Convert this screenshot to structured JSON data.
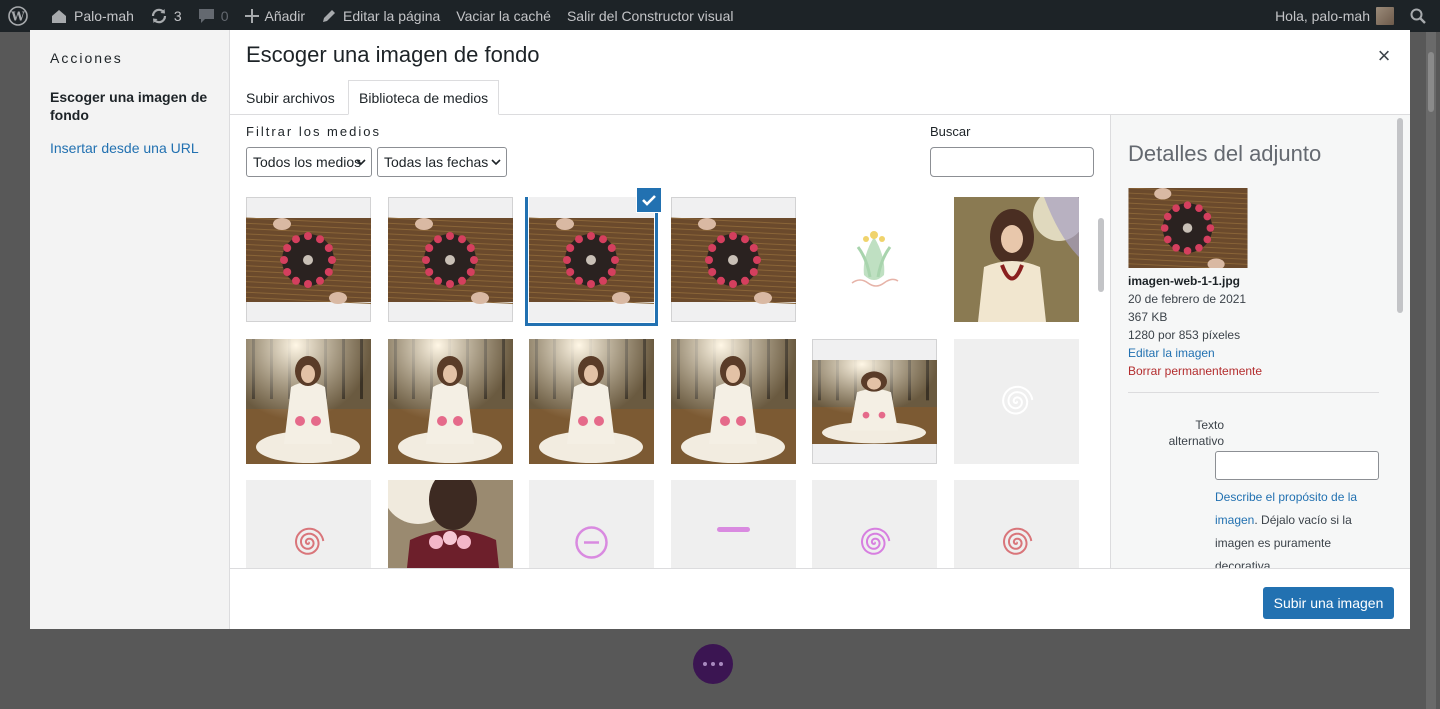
{
  "admin_bar": {
    "site_name": "Palo-mah",
    "updates_count": "3",
    "comments_count": "0",
    "new_label": "Añadir",
    "edit_label": "Editar la página",
    "cache_label": "Vaciar la caché",
    "exit_label": "Salir del Constructor visual",
    "greeting": "Hola, palo-mah"
  },
  "modal": {
    "menu_title": "Acciones",
    "menu_active": "Escoger una imagen de fondo",
    "menu_link": "Insertar desde una URL",
    "title": "Escoger una imagen de fondo",
    "close": "×",
    "tabs": [
      {
        "label": "Subir archivos",
        "active": false
      },
      {
        "label": "Biblioteca de medios",
        "active": true
      }
    ],
    "filter_label": "Filtrar los medios",
    "type_filter": "Todos los medios",
    "date_filter": "Todas las fechas",
    "search_label": "Buscar",
    "search_value": ""
  },
  "attachments": [
    {
      "kind": "mandala-wide",
      "selected": false
    },
    {
      "kind": "mandala-wide",
      "selected": false
    },
    {
      "kind": "mandala-wide",
      "selected": true
    },
    {
      "kind": "mandala-wide",
      "selected": false
    },
    {
      "kind": "logo",
      "selected": false
    },
    {
      "kind": "portrait",
      "selected": false
    },
    {
      "kind": "seated",
      "selected": false
    },
    {
      "kind": "seated",
      "selected": false
    },
    {
      "kind": "seated",
      "selected": false
    },
    {
      "kind": "seated",
      "selected": false
    },
    {
      "kind": "seated-wide",
      "selected": false
    },
    {
      "kind": "spiral-white",
      "selected": false
    },
    {
      "kind": "spiral-red",
      "selected": false
    },
    {
      "kind": "roses",
      "selected": false
    },
    {
      "kind": "circle-minus",
      "selected": false
    },
    {
      "kind": "dash",
      "selected": false
    },
    {
      "kind": "spiral-pink",
      "selected": false
    },
    {
      "kind": "spiral-red",
      "selected": false
    }
  ],
  "details": {
    "title": "Detalles del adjunto",
    "filename": "imagen-web-1-1.jpg",
    "date": "20 de febrero de 2021",
    "size": "367 KB",
    "dimensions": "1280 por 853 píxeles",
    "edit_link": "Editar la imagen",
    "delete_link": "Borrar permanentemente",
    "alt_label": "Texto alternativo",
    "alt_value": "",
    "alt_help_link": "Describe el propósito de la imagen",
    "alt_help_text": ". Déjalo vacío si la imagen es puramente decorativa."
  },
  "footer": {
    "button_label": "Subir una imagen"
  },
  "colors": {
    "accent": "#2271b1",
    "danger": "#b32d2e",
    "admin_bar": "#1d2327"
  }
}
